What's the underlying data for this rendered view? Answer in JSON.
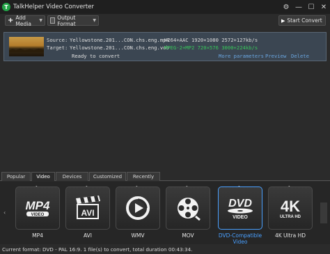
{
  "window": {
    "title": "TalkHelper Video Converter",
    "logo_letter": "T",
    "controls": [
      "⚙",
      "—",
      "☐",
      "✕"
    ]
  },
  "toolbar": {
    "add_media": "Add Media",
    "output_format": "Output Format",
    "start_convert": "Start Convert"
  },
  "job": {
    "source_label": "Source:",
    "source_name": "Yellowstone.201...CON.chs.eng.mp4",
    "source_info": "H264+AAC 1920×1080 2572+127kb/s",
    "target_label": "Target:",
    "target_name": "Yellowstone.201...CON.chs.eng.vob",
    "target_codec": "MPEG-2+MP2",
    "target_res": "720×576",
    "target_bitrate": "3000+224kb/s",
    "status": "Ready to convert",
    "more_params": "More parameters",
    "preview": "Preview",
    "delete": "Delete"
  },
  "tabs": [
    "Popular",
    "Video",
    "Devices",
    "Customized",
    "Recently"
  ],
  "active_tab": "Video",
  "formats": [
    {
      "label": "MP4",
      "icon": "mp4-icon"
    },
    {
      "label": "AVI",
      "icon": "avi-clapper-icon"
    },
    {
      "label": "WMV",
      "icon": "wmv-play-icon"
    },
    {
      "label": "MOV",
      "icon": "mov-film-reel-icon"
    },
    {
      "label": "DVD-Compatible Video",
      "icon": "dvd-video-icon",
      "selected": true
    },
    {
      "label": "4K Ultra HD",
      "icon": "4k-ultra-hd-icon"
    }
  ],
  "status_bar": "Current format: DVD - PAL 16:9. 1 file(s) to convert, total duration 00:43:34.",
  "colors": {
    "accent": "#4aa0ff",
    "link": "#6aa6e0",
    "green_text": "#38c75a",
    "logo": "#22a447"
  }
}
